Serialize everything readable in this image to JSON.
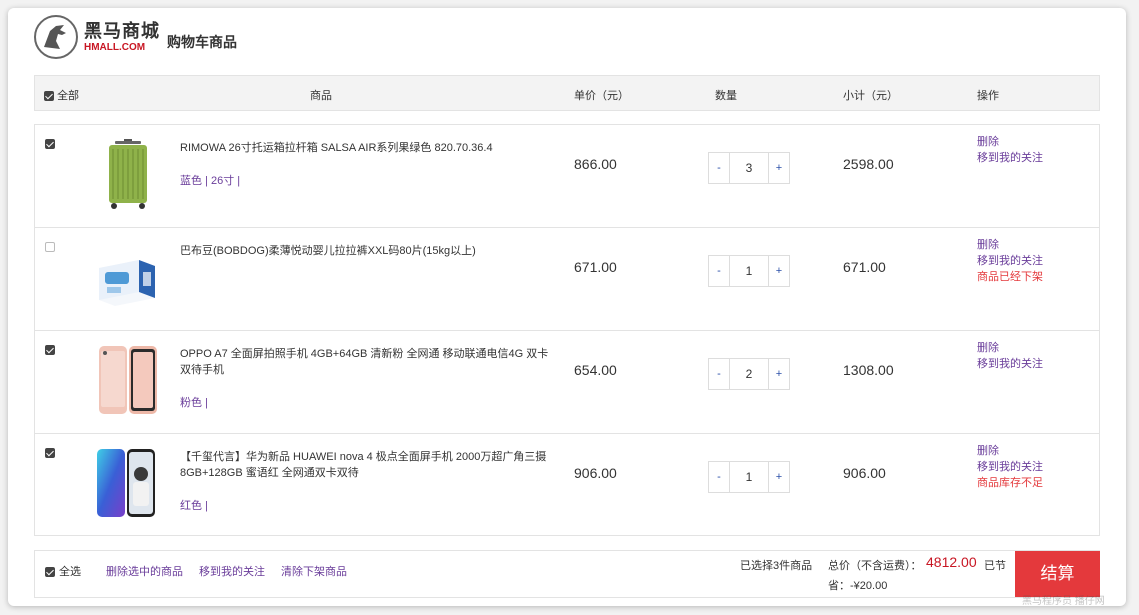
{
  "header": {
    "brand_cn": "黑马商城",
    "brand_en": "HMALL.COM",
    "page_title": "购物车商品"
  },
  "table_header": {
    "select_all": "全部",
    "product": "商品",
    "unit_price": "单价（元）",
    "quantity": "数量",
    "subtotal": "小计（元）",
    "actions": "操作"
  },
  "items": [
    {
      "checked": true,
      "name": "RIMOWA 26寸托运箱拉杆箱 SALSA AIR系列果绿色 820.70.36.4",
      "attrs": "蓝色 | 26寸 |",
      "price": "866.00",
      "qty": "3",
      "subtotal": "2598.00",
      "delete": "删除",
      "favorite": "移到我的关注",
      "notice": "",
      "thumb_icon": "luggage-image"
    },
    {
      "checked": false,
      "name": "巴布豆(BOBDOG)柔薄悦动婴儿拉拉裤XXL码80片(15kg以上)",
      "attrs": "",
      "price": "671.00",
      "qty": "1",
      "subtotal": "671.00",
      "delete": "删除",
      "favorite": "移到我的关注",
      "notice": "商品已经下架",
      "thumb_icon": "diaper-box-image"
    },
    {
      "checked": true,
      "name": "OPPO A7 全面屏拍照手机 4GB+64GB 清新粉 全网通 移动联通电信4G 双卡双待手机",
      "attrs": "粉色 |",
      "price": "654.00",
      "qty": "2",
      "subtotal": "1308.00",
      "delete": "删除",
      "favorite": "移到我的关注",
      "notice": "",
      "thumb_icon": "pink-phone-image"
    },
    {
      "checked": true,
      "name": "【千玺代言】华为新品 HUAWEI nova 4 极点全面屏手机 2000万超广角三摄 8GB+128GB 蜜语红 全网通双卡双待",
      "attrs": "红色 |",
      "price": "906.00",
      "qty": "1",
      "subtotal": "906.00",
      "delete": "删除",
      "favorite": "移到我的关注",
      "notice": "商品库存不足",
      "thumb_icon": "blue-phone-image"
    }
  ],
  "footer": {
    "select_all": "全选",
    "delete_selected": "删除选中的商品",
    "move_to_favorites": "移到我的关注",
    "clear_offline": "清除下架商品",
    "selected_count": "已选择3件商品",
    "total_label": "总价（不含运费）：",
    "total_value": "4812.00",
    "total_tail": "已节",
    "savings": "省：-¥20.00",
    "checkout": "结算"
  },
  "watermark": "黑马程序员 播仔网",
  "colors": {
    "accent_red": "#e4393c",
    "price_red": "#c81623",
    "link_purple": "#6a3d9a",
    "qty_blue": "#2a4fa8"
  }
}
